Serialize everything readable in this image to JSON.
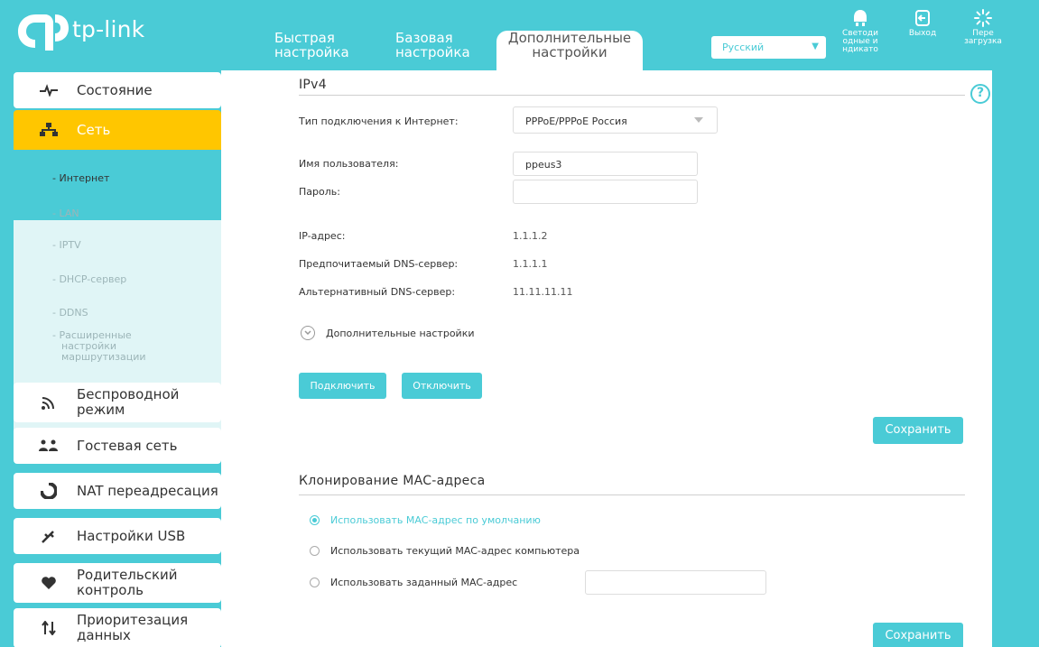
{
  "header": {
    "logo_text": "tp-link",
    "tabs": [
      {
        "line1": "Быстрая",
        "line2": "настройка"
      },
      {
        "line1": "Базовая",
        "line2": "настройка"
      },
      {
        "line1": "Дополнительные",
        "line2": "настройки"
      }
    ],
    "language": "Русский",
    "buttons": {
      "leds": {
        "l1": "Светоди",
        "l2": "одные и",
        "l3": "ндикато"
      },
      "logout": "Выход",
      "reboot": {
        "l1": "Пере",
        "l2": "загрузка"
      }
    }
  },
  "sidebar": {
    "items": [
      {
        "label": "Состояние",
        "icon": "pulse-icon"
      },
      {
        "label": "Сеть",
        "icon": "network-icon"
      },
      {
        "label": "Беспроводной режим",
        "icon": "wireless-icon"
      },
      {
        "label": "Гостевая сеть",
        "icon": "guest-users-icon"
      },
      {
        "label": "NAT переадресация",
        "icon": "nat-icon"
      },
      {
        "label": "Настройки USB",
        "icon": "usb-icon"
      },
      {
        "label": "Родительский контроль",
        "icon": "heart-icon"
      },
      {
        "label": "Приоритезация данных",
        "icon": "priority-arrows-icon"
      }
    ],
    "submenu": [
      "- Интернет",
      "- LAN",
      "- IPTV",
      "- DHCP-сервер",
      "- DDNS",
      "- Расширенные",
      "настройки",
      "маршрутизации"
    ]
  },
  "ipv4": {
    "title": "IPv4",
    "connection_type_label": "Тип подключения к Интернет:",
    "connection_type_value": "PPPoE/PPPoE Россия",
    "username_label": "Имя пользователя:",
    "username_value": "ppeus3",
    "password_label": "Пароль:",
    "password_value": "",
    "ip_label": "IP-адрес:",
    "ip_value": "1.1.1.2",
    "dns1_label": "Предпочитаемый DNS-сервер:",
    "dns1_value": "1.1.1.1",
    "dns2_label": "Альтернативный DNS-сервер:",
    "dns2_value": "11.11.11.11",
    "advanced_toggle": "Дополнительные настройки",
    "connect_button": "Подключить",
    "disconnect_button": "Отключить",
    "save_button": "Сохранить"
  },
  "mac_clone": {
    "title": "Клонирование MAC-адреса",
    "options": [
      "Использовать MAC-адрес по умолчанию",
      "Использовать текущий MAC-адрес компьютера",
      "Использовать заданный MAC-адрес"
    ],
    "selected_index": 0,
    "custom_mac_value": "",
    "save_button": "Сохранить"
  },
  "colors": {
    "accent": "#4acbd6",
    "active_menu": "#ffc600",
    "submenu_bg": "#e0f5f6"
  }
}
